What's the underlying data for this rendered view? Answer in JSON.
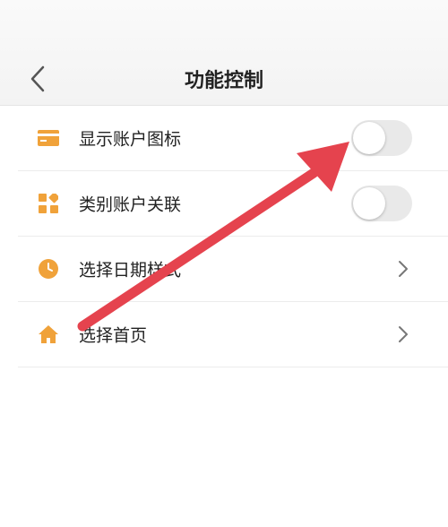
{
  "header": {
    "title": "功能控制"
  },
  "icons": {
    "back": "back-chevron-icon",
    "card": "card-icon",
    "category": "category-grid-icon",
    "clock": "clock-icon",
    "home": "home-icon",
    "chevron_right": "chevron-right-icon"
  },
  "colors": {
    "accent": "#F0A23A",
    "annotation_arrow": "#E5434E",
    "toggle_off": "#E9E9E9"
  },
  "settings": {
    "items": [
      {
        "label": "显示账户图标",
        "control": "toggle",
        "on": false
      },
      {
        "label": "类别账户关联",
        "control": "toggle",
        "on": false
      },
      {
        "label": "选择日期样式",
        "control": "chevron"
      },
      {
        "label": "选择首页",
        "control": "chevron"
      }
    ]
  }
}
